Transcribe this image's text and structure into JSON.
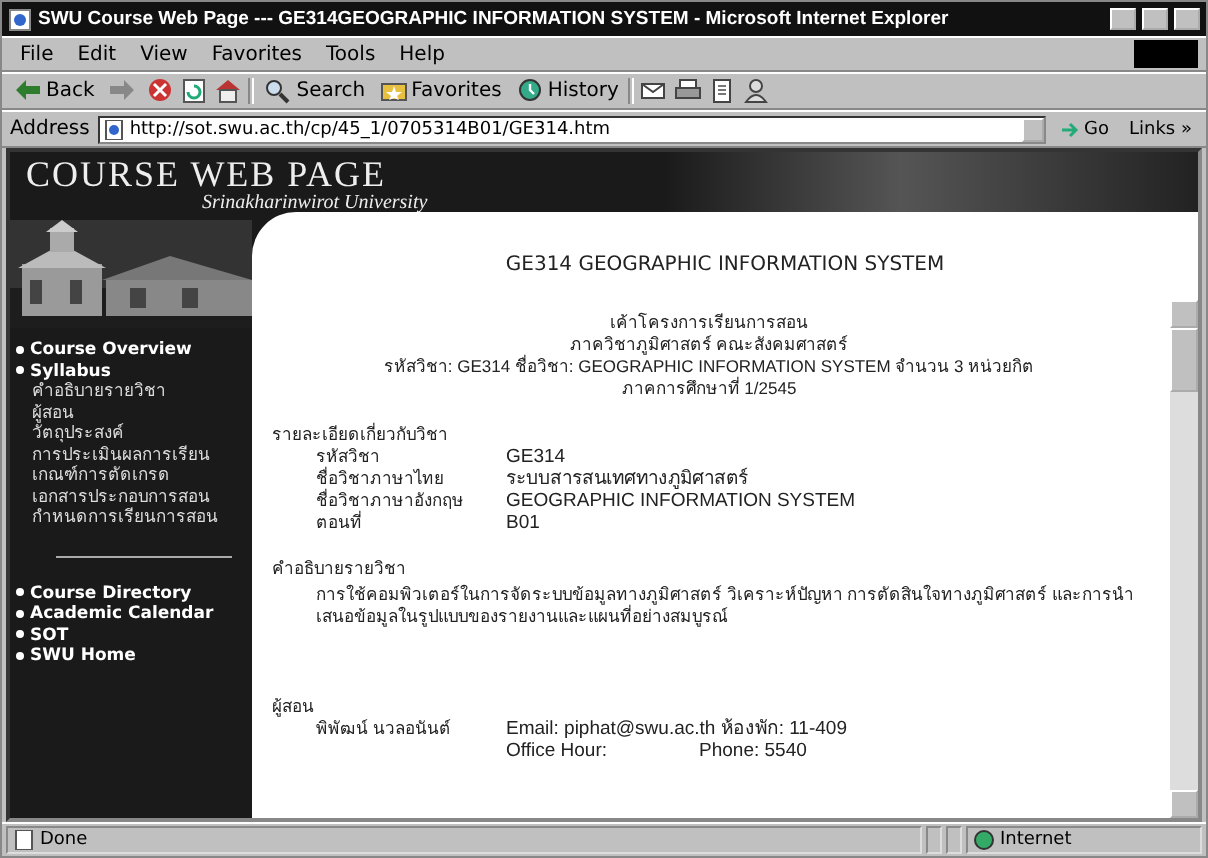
{
  "window": {
    "title": "SWU Course Web Page --- GE314GEOGRAPHIC INFORMATION SYSTEM - Microsoft Internet Explorer"
  },
  "menu": [
    "File",
    "Edit",
    "View",
    "Favorites",
    "Tools",
    "Help"
  ],
  "toolbar": [
    {
      "kind": "back",
      "label": "Back"
    },
    {
      "kind": "forward"
    },
    {
      "kind": "stop"
    },
    {
      "kind": "refresh"
    },
    {
      "kind": "home"
    },
    {
      "kind": "search",
      "label": "Search"
    },
    {
      "kind": "favorites",
      "label": "Favorites"
    },
    {
      "kind": "history",
      "label": "History"
    },
    {
      "kind": "mail"
    },
    {
      "kind": "print"
    },
    {
      "kind": "edit"
    },
    {
      "kind": "messenger"
    }
  ],
  "address": {
    "label": "Address",
    "value": "http://sot.swu.ac.th/cp/45_1/0705314B01/GE314.htm",
    "go": "Go",
    "links": "Links »"
  },
  "banner": {
    "title": "COURSE WEB PAGE",
    "subtitle": "Srinakharinwirot University"
  },
  "sidebar": {
    "items": [
      {
        "label": "Course Overview",
        "kind": "main"
      },
      {
        "label": "Syllabus",
        "kind": "main"
      },
      {
        "label": "คำอธิบายรายวิชา",
        "kind": "sub"
      },
      {
        "label": "ผู้สอน",
        "kind": "sub"
      },
      {
        "label": "วัตถุประสงค์",
        "kind": "sub"
      },
      {
        "label": "การประเมินผลการเรียน",
        "kind": "sub"
      },
      {
        "label": "เกณฑ์การตัดเกรด",
        "kind": "sub"
      },
      {
        "label": "เอกสารประกอบการสอน",
        "kind": "sub"
      },
      {
        "label": "กำหนดการเรียนการสอน",
        "kind": "sub"
      },
      {
        "kind": "divider"
      },
      {
        "label": "Course Directory",
        "kind": "main"
      },
      {
        "label": "Academic Calendar",
        "kind": "main"
      },
      {
        "label": "SOT",
        "kind": "main"
      },
      {
        "label": "SWU Home",
        "kind": "main"
      }
    ]
  },
  "page": {
    "title": "GE314 GEOGRAPHIC INFORMATION SYSTEM",
    "header_lines": [
      "เค้าโครงการเรียนการสอน",
      "ภาควิชาภูมิศาสตร์ คณะสังคมศาสตร์",
      "รหัสวิชา: GE314 ชื่อวิชา: GEOGRAPHIC INFORMATION SYSTEM จำนวน 3 หน่วยกิต",
      "ภาคการศึกษาที่ 1/2545"
    ],
    "sections": [
      {
        "heading": "รายละเอียดเกี่ยวกับวิชา",
        "kind": "fields",
        "rows": [
          {
            "label": "รหัสวิชา",
            "value": "GE314"
          },
          {
            "label": "ชื่อวิชาภาษาไทย",
            "value": "ระบบสารสนเทศทางภูมิศาสตร์"
          },
          {
            "label": "ชื่อวิชาภาษาอังกฤษ",
            "value": "GEOGRAPHIC INFORMATION SYSTEM"
          },
          {
            "label": "ตอนที่",
            "value": "B01"
          }
        ]
      },
      {
        "heading": "คำอธิบายรายวิชา",
        "kind": "text",
        "text": "การใช้คอมพิวเตอร์ในการจัดระบบข้อมูลทางภูมิศาสตร์ วิเคราะห์ปัญหา การตัดสินใจทางภูมิศาสตร์ และการนำเสนอข้อมูลในรูปแบบของรายงานและแผนที่อย่างสมบูรณ์"
      },
      {
        "heading": "ผู้สอน",
        "kind": "fields",
        "rows": [
          {
            "label": "พิพัฒน์ นวลอนันต์",
            "value": "Email: piphat@swu.ac.th ห้องพัก: 11-409"
          },
          {
            "label": "",
            "value": "Office Hour:",
            "extra": "Phone: 5540"
          }
        ]
      }
    ]
  },
  "status_bar": {
    "text": "Done",
    "zone": "Internet"
  }
}
